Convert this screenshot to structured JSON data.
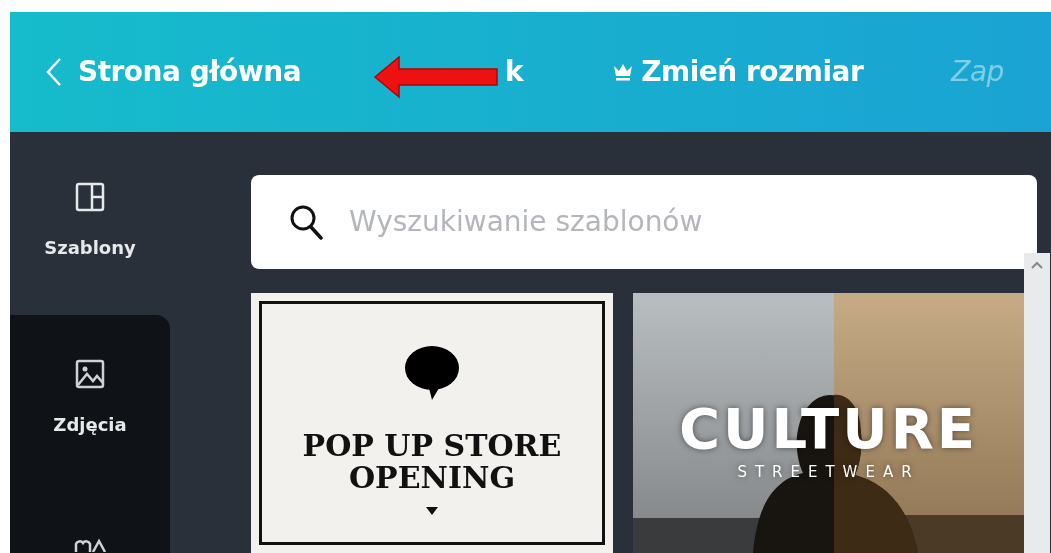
{
  "top_bar": {
    "back_label": "Strona główna",
    "menu": [
      {
        "label": "k",
        "kind": "text"
      },
      {
        "label": "Zmień rozmiar",
        "kind": "premium"
      },
      {
        "label": "Zap",
        "kind": "faded"
      }
    ]
  },
  "sidebar": {
    "items": [
      {
        "label": "Szablony",
        "kind": "templates",
        "selected": true
      },
      {
        "label": "Zdjęcia",
        "kind": "photos",
        "selected": false
      },
      {
        "kind": "elements",
        "selected": false
      }
    ]
  },
  "search": {
    "placeholder": "Wyszukiwanie szablonów"
  },
  "templates": [
    {
      "kind": "poster",
      "title": "POP UP STORE OPENING"
    },
    {
      "title": "CULTURE",
      "subtitle": "STREETWEAR"
    }
  ]
}
